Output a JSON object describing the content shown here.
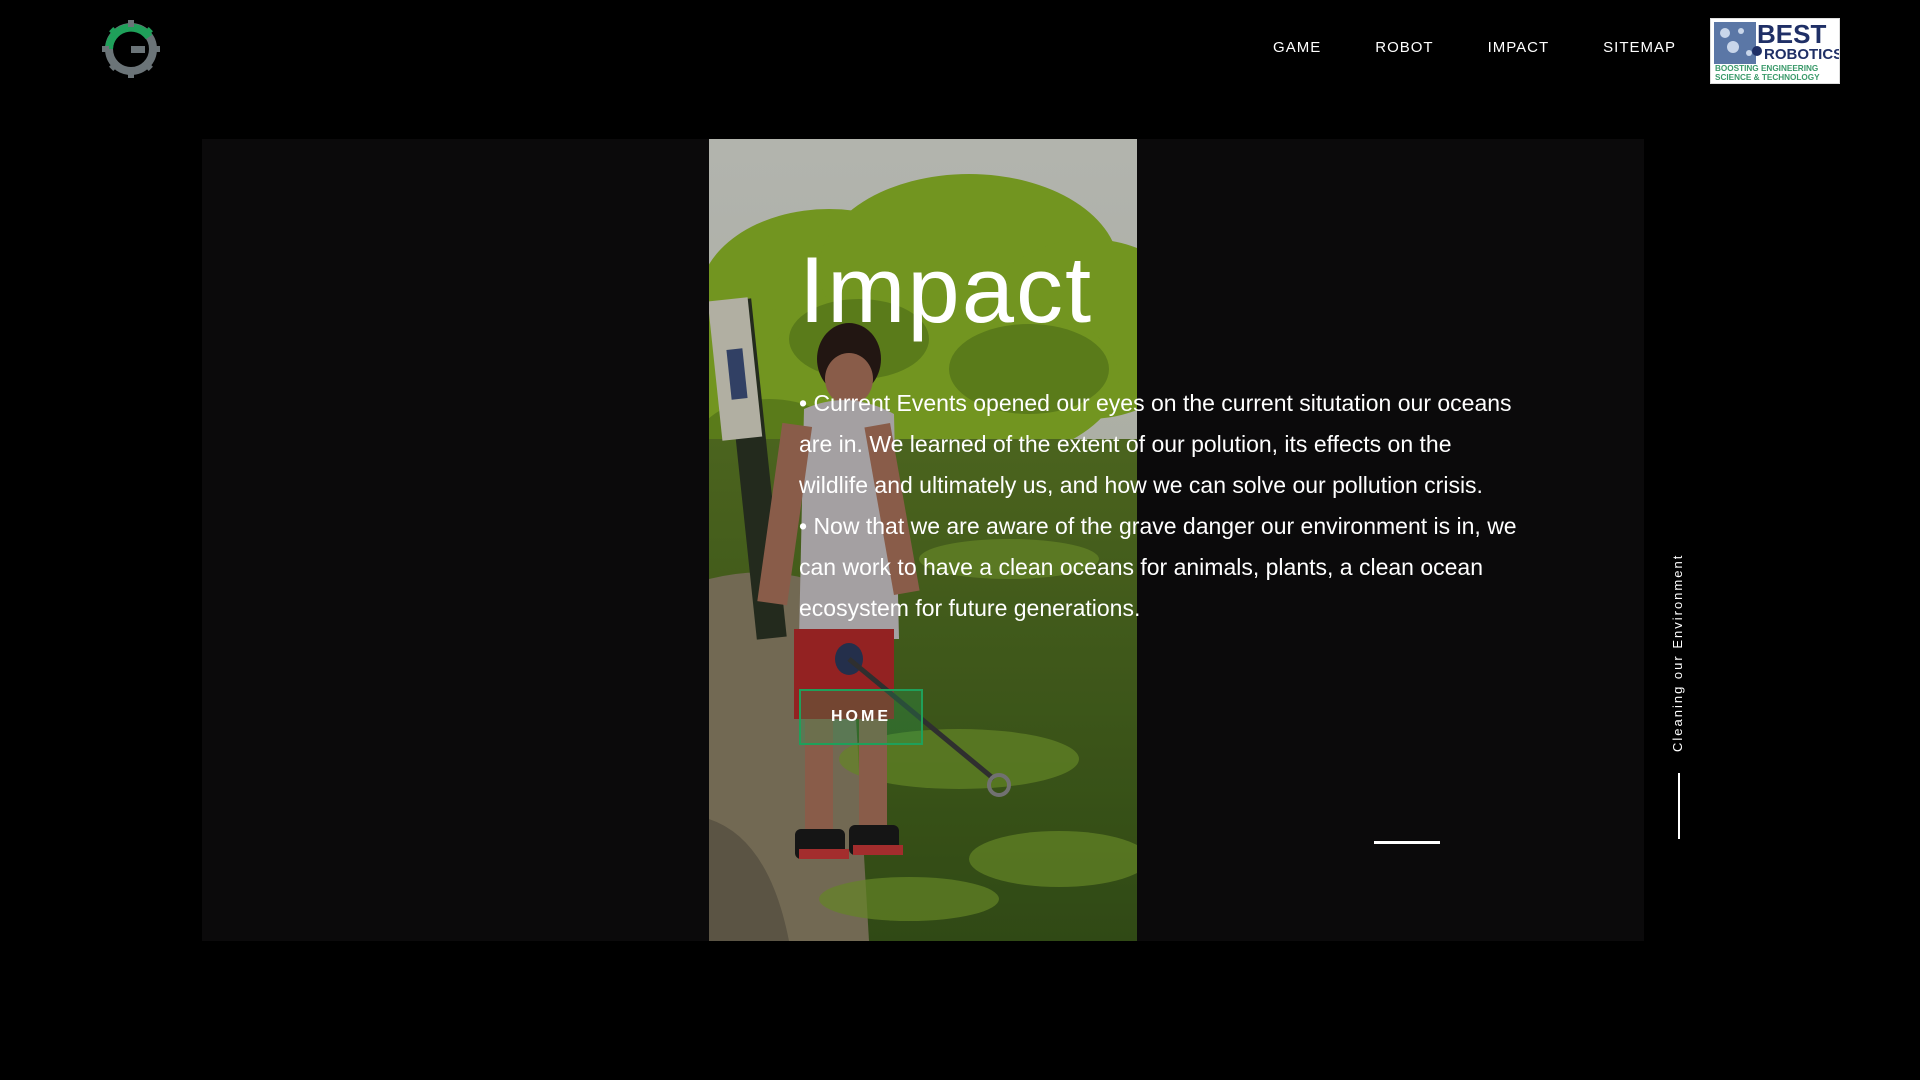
{
  "header": {
    "nav": [
      {
        "label": "GAME"
      },
      {
        "label": "ROBOT"
      },
      {
        "label": "IMPACT"
      },
      {
        "label": "SITEMAP"
      }
    ],
    "partner_logo": {
      "line1": "BEST",
      "line2": "ROBOTICS",
      "tagline1": "BOOSTING ENGINEERING",
      "tagline2": "SCIENCE & TECHNOLOGY"
    }
  },
  "hero": {
    "title": "Impact",
    "paragraphs": [
      "• Current Events opened our eyes on the current situtation our oceans are in. We learned of the extent of our polution, its effects on the wildlife and ultimately us, and how we can solve our pollution crisis.",
      "• Now that we are aware of the grave danger our environment is in, we can work to have a clean oceans for animals, plants, a clean ocean ecosystem for future generations."
    ],
    "button_label": "HOME"
  },
  "side": {
    "label": "Cleaning our Environment"
  },
  "colors": {
    "accent": "#1fa05a",
    "background": "#000000",
    "panel": "#0b0a0b"
  }
}
